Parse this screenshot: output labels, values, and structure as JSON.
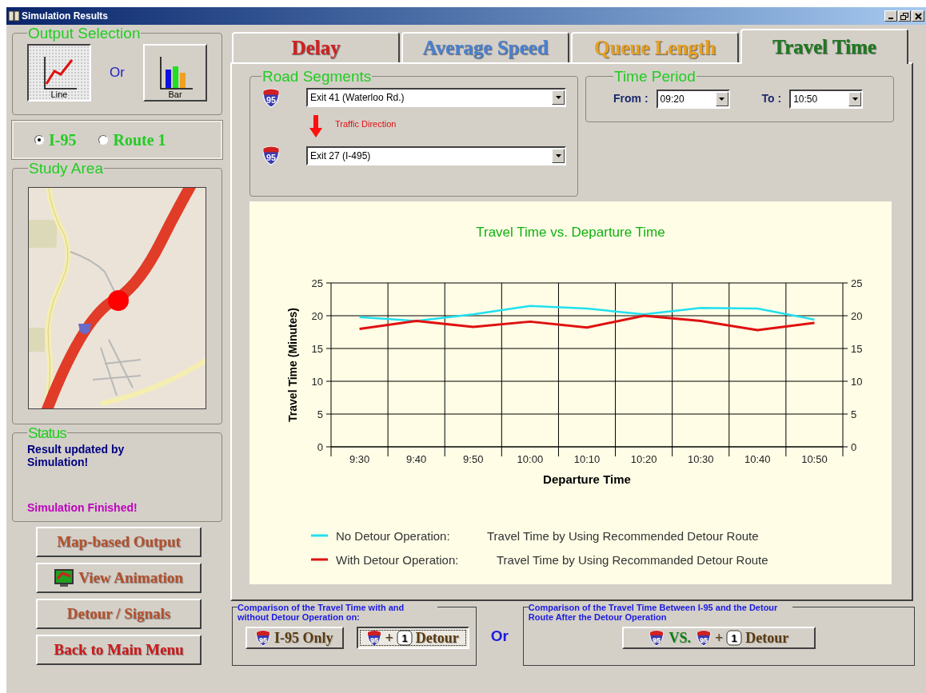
{
  "window": {
    "title": "Simulation Results"
  },
  "output_selection": {
    "title": "Output Selection",
    "separator": "Or",
    "options": [
      {
        "label": "Line",
        "kind": "line",
        "selected": true
      },
      {
        "label": "Bar",
        "kind": "bar",
        "selected": false
      }
    ]
  },
  "routes": [
    {
      "label": "I-95",
      "selected": true
    },
    {
      "label": "Route 1",
      "selected": false
    }
  ],
  "study_area": {
    "title": "Study Area"
  },
  "status": {
    "title": "Status",
    "messages": [
      {
        "text": "Result updated by Simulation!",
        "color": "#000080"
      },
      {
        "text": "Simulation Finished!",
        "color": "#c000c0"
      }
    ]
  },
  "actions": [
    {
      "label": "Map-based Output",
      "color": "#b4502c",
      "kind": "plain"
    },
    {
      "label": "View Animation",
      "color": "#b4502c",
      "kind": "monitor"
    },
    {
      "label": "Detour / Signals",
      "color": "#b4502c",
      "kind": "plain"
    },
    {
      "label": "Back to Main Menu",
      "color": "#d01818",
      "kind": "plain"
    }
  ],
  "tabs": [
    {
      "label": "Delay",
      "color": "#d42020",
      "selected": false
    },
    {
      "label": "Average Speed",
      "color": "#4a80d0",
      "selected": false
    },
    {
      "label": "Queue Length",
      "color": "#e8a020",
      "selected": false
    },
    {
      "label": "Travel Time",
      "color": "#1c7a1c",
      "selected": true
    }
  ],
  "road_segments": {
    "title": "Road Segments",
    "direction_label": "Traffic Direction",
    "segments": [
      {
        "shield": "95",
        "value": "Exit 41 (Waterloo Rd.)"
      },
      {
        "shield": "95",
        "value": "Exit 27 (I-495)"
      }
    ]
  },
  "time_period": {
    "title": "Time Period",
    "fields": [
      {
        "label": "From :",
        "value": "09:20"
      },
      {
        "label": "To :",
        "value": "10:50"
      }
    ]
  },
  "chart": {
    "chart_data": {
      "type": "line",
      "title": "Travel Time vs. Departure Time",
      "xlabel": "Departure Time",
      "ylabel": "Travel Time (Minutes)",
      "categories": [
        "9:30",
        "9:40",
        "9:50",
        "10:00",
        "10:10",
        "10:20",
        "10:30",
        "10:40",
        "10:50"
      ],
      "series": [
        {
          "name": "No Detour Operation:",
          "color": "#20e0f0",
          "values": [
            19.8,
            19.2,
            20.2,
            21.5,
            21.1,
            20.2,
            21.2,
            21.1,
            19.4
          ]
        },
        {
          "name": "With Detour Operation:",
          "color": "#e01010",
          "values": [
            18.0,
            19.2,
            18.3,
            19.1,
            18.2,
            20.0,
            19.2,
            17.8,
            18.9
          ]
        }
      ],
      "ylim": [
        0,
        25
      ],
      "yticks": [
        0,
        5,
        10,
        15,
        20,
        25
      ],
      "grid": true,
      "legend": "bottom"
    },
    "right_yticks": [
      "25",
      "20",
      "15",
      "10",
      "5",
      "0"
    ],
    "legend_descriptions": [
      "Travel Time by Using Recommended Detour Route",
      "Travel Time by Using Recommanded Detour Route"
    ]
  },
  "comparisons": {
    "separator": "Or",
    "groups": [
      {
        "title": "Comparison of the Travel Time with and without Detour Operation on:",
        "buttons": [
          {
            "selected": false,
            "parts": [
              {
                "kind": "shield",
                "text": "95"
              },
              {
                "kind": "text",
                "text": "I-95 Only"
              }
            ]
          },
          {
            "selected": true,
            "parts": [
              {
                "kind": "shield",
                "text": "95"
              },
              {
                "kind": "text",
                "text": "+"
              },
              {
                "kind": "route",
                "text": "1"
              },
              {
                "kind": "text",
                "text": "Detour"
              }
            ]
          }
        ]
      },
      {
        "title": "Comparison of the Travel Time Between I-95 and the Detour Route After the Detour Operation",
        "buttons": [
          {
            "selected": false,
            "parts": [
              {
                "kind": "shield",
                "text": "95"
              },
              {
                "kind": "green",
                "text": "VS."
              },
              {
                "kind": "shield",
                "text": "95"
              },
              {
                "kind": "text",
                "text": "+"
              },
              {
                "kind": "route",
                "text": "1"
              },
              {
                "kind": "text",
                "text": "Detour"
              }
            ]
          }
        ]
      }
    ]
  }
}
